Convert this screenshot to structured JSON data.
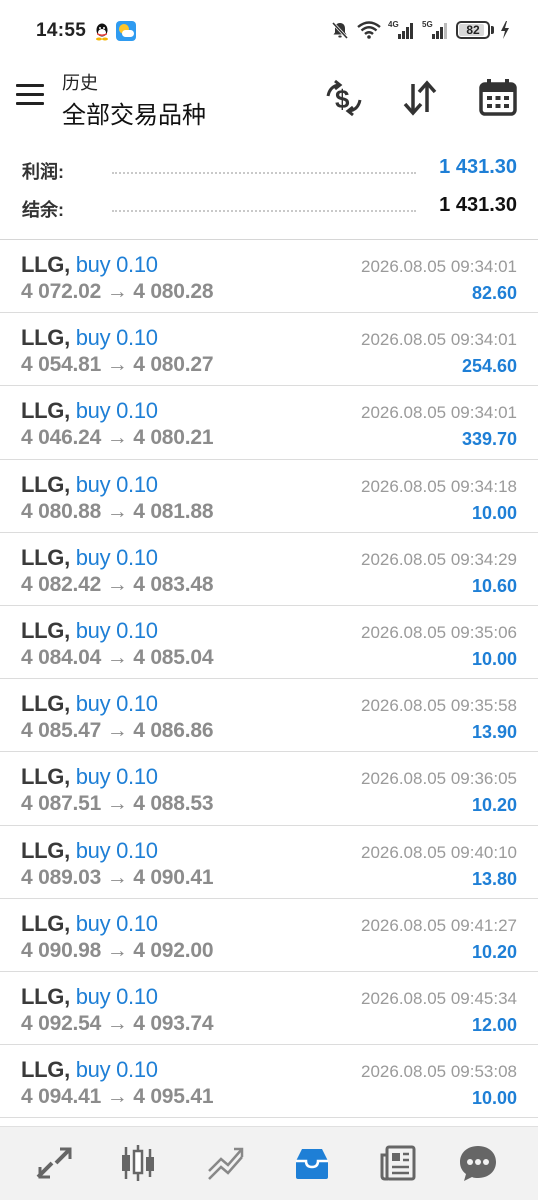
{
  "status_bar": {
    "time": "14:55",
    "network_4g": "4G",
    "network_5g": "5G",
    "battery": "82",
    "icons": [
      "qq-icon",
      "weather-icon",
      "mute-bell-icon",
      "wifi-icon",
      "signal-4g-icon",
      "signal-5g-icon",
      "battery-icon",
      "charging-icon"
    ]
  },
  "toolbar": {
    "subtitle": "历史",
    "title": "全部交易品种",
    "icons": [
      "menu-icon",
      "currency-exchange-icon",
      "sort-icon",
      "calendar-icon"
    ]
  },
  "summary": {
    "profit_label": "利润:",
    "profit_value": "1 431.30",
    "balance_label": "结余:",
    "balance_value": "1 431.30",
    "colors": {
      "profit": "#1e7fd6",
      "balance": "#111111"
    }
  },
  "trades": [
    {
      "symbol": "LLG,",
      "side": "buy 0.10",
      "prices": "4 072.02 → 4 080.28",
      "time": "2026.08.05 09:34:01",
      "profit": "82.60"
    },
    {
      "symbol": "LLG,",
      "side": "buy 0.10",
      "prices": "4 054.81 → 4 080.27",
      "time": "2026.08.05 09:34:01",
      "profit": "254.60"
    },
    {
      "symbol": "LLG,",
      "side": "buy 0.10",
      "prices": "4 046.24 → 4 080.21",
      "time": "2026.08.05 09:34:01",
      "profit": "339.70"
    },
    {
      "symbol": "LLG,",
      "side": "buy 0.10",
      "prices": "4 080.88 → 4 081.88",
      "time": "2026.08.05 09:34:18",
      "profit": "10.00"
    },
    {
      "symbol": "LLG,",
      "side": "buy 0.10",
      "prices": "4 082.42 → 4 083.48",
      "time": "2026.08.05 09:34:29",
      "profit": "10.60"
    },
    {
      "symbol": "LLG,",
      "side": "buy 0.10",
      "prices": "4 084.04 → 4 085.04",
      "time": "2026.08.05 09:35:06",
      "profit": "10.00"
    },
    {
      "symbol": "LLG,",
      "side": "buy 0.10",
      "prices": "4 085.47 → 4 086.86",
      "time": "2026.08.05 09:35:58",
      "profit": "13.90"
    },
    {
      "symbol": "LLG,",
      "side": "buy 0.10",
      "prices": "4 087.51 → 4 088.53",
      "time": "2026.08.05 09:36:05",
      "profit": "10.20"
    },
    {
      "symbol": "LLG,",
      "side": "buy 0.10",
      "prices": "4 089.03 → 4 090.41",
      "time": "2026.08.05 09:40:10",
      "profit": "13.80"
    },
    {
      "symbol": "LLG,",
      "side": "buy 0.10",
      "prices": "4 090.98 → 4 092.00",
      "time": "2026.08.05 09:41:27",
      "profit": "10.20"
    },
    {
      "symbol": "LLG,",
      "side": "buy 0.10",
      "prices": "4 092.54 → 4 093.74",
      "time": "2026.08.05 09:45:34",
      "profit": "12.00"
    },
    {
      "symbol": "LLG,",
      "side": "buy 0.10",
      "prices": "4 094.41 → 4 095.41",
      "time": "2026.08.05 09:53:08",
      "profit": "10.00"
    }
  ],
  "trade_colors": {
    "side": "#1e7fd6",
    "profit": "#1e7fd6",
    "prices": "#8c8c8c"
  },
  "bottom_nav": {
    "items": [
      "quotes-icon",
      "chart-icon",
      "trade-icon",
      "history-icon",
      "news-icon",
      "chat-icon"
    ],
    "active": "history-icon",
    "active_color": "#1e7fd6"
  }
}
